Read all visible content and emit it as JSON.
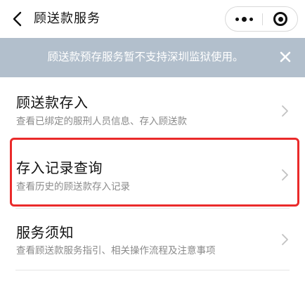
{
  "navbar": {
    "title": "顾送款服务"
  },
  "notice": {
    "text": "顾送款预存服务暂不支持深圳监狱使用。"
  },
  "menu": [
    {
      "title": "顾送款存入",
      "desc": "查看已绑定的服刑人员信息、存入顾送款"
    },
    {
      "title": "存入记录查询",
      "desc": "查看历史的顾送款存入记录"
    },
    {
      "title": "服务须知",
      "desc": "查看顾送款服务指引、相关操作流程及注意事项"
    }
  ],
  "colors": {
    "notice_bg": "#b2bfcc",
    "highlight": "#ea2a2a",
    "desc_text": "#8a8a8a"
  },
  "icons": [
    "back-arrow-icon",
    "more-dots-icon",
    "close-miniprogram-icon",
    "close-icon",
    "chevron-right-icon"
  ]
}
